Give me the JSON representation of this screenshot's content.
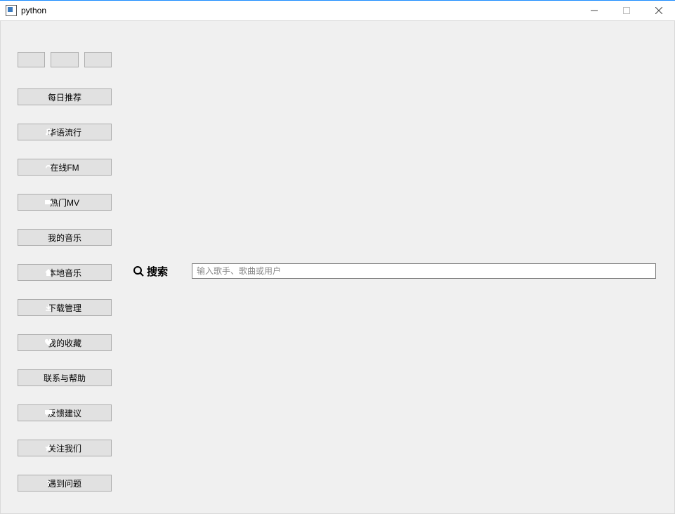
{
  "window": {
    "title": "python"
  },
  "sidebar": {
    "items": [
      {
        "label": "每日推荐",
        "icon": null
      },
      {
        "label": "华语流行",
        "icon": "music-note-icon"
      },
      {
        "label": "在线FM",
        "icon": "radio-icon"
      },
      {
        "label": "热门MV",
        "icon": "video-icon"
      },
      {
        "label": "我的音乐",
        "icon": null
      },
      {
        "label": "本地音乐",
        "icon": "home-icon"
      },
      {
        "label": "下载管理",
        "icon": "download-icon"
      },
      {
        "label": "我的收藏",
        "icon": "heart-icon"
      },
      {
        "label": "联系与帮助",
        "icon": null
      },
      {
        "label": "反馈建议",
        "icon": "chat-icon"
      },
      {
        "label": "关注我们",
        "icon": "star-icon"
      },
      {
        "label": "遇到问题",
        "icon": "question-icon"
      }
    ]
  },
  "search": {
    "label": "搜索",
    "placeholder": "输入歌手、歌曲或用户"
  }
}
